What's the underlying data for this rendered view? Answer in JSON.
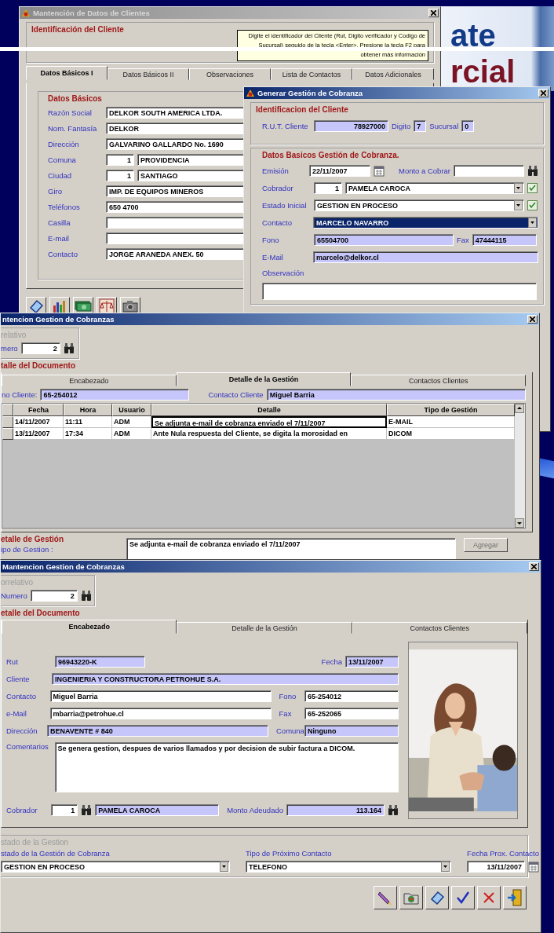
{
  "slide_heading": {
    "line_1": "ate",
    "line_2": "rcial"
  },
  "client_window": {
    "title": "Mantención de Datos de Clientes",
    "active": false,
    "id_group": {
      "title": "Identificación del Cliente",
      "hint": "Digite el identificador del Cliente (Rut, Digito verificador y Codigo de Sucursal) seguido de la tecla <Enter>. Presione la tecla F2 para obtener más información"
    },
    "tabs": [
      {
        "label": "Datos Básicos I",
        "selected": true
      },
      {
        "label": "Datos Básicos II",
        "selected": false
      },
      {
        "label": "Observaciones",
        "selected": false
      },
      {
        "label": "Lista de Contactos",
        "selected": false
      },
      {
        "label": "Datos Adicionales",
        "selected": false
      }
    ],
    "group_title": "Datos Básicos",
    "fields": [
      {
        "label": "Razón Social",
        "value": "DELKOR SOUTH AMERICA LTDA."
      },
      {
        "label": "Nom. Fantasía",
        "value": "DELKOR"
      },
      {
        "label": "Dirección",
        "value": "GALVARINO GALLARDO  No. 1690"
      },
      {
        "label": "Comuna",
        "code": "1",
        "value": "PROVIDENCIA"
      },
      {
        "label": "Ciudad",
        "code": "1",
        "value": "SANTIAGO"
      },
      {
        "label": "Giro",
        "value": "IMP. DE EQUIPOS MINEROS"
      },
      {
        "label": "Teléfonos",
        "value": "650 4700"
      },
      {
        "label": "Casilla"
      },
      {
        "label": "E-mail"
      },
      {
        "label": "Contacto",
        "value": "JORGE ARANEDA ANEX. 50"
      }
    ]
  },
  "gestion_window": {
    "title": "Generar Gestión de Cobranza",
    "active": true,
    "id_group": {
      "title": "Identificacion del Cliente",
      "rut_label": "R.U.T. Cliente",
      "rut": "78927000",
      "digit_label": "Digito",
      "digit": "7",
      "branch_label": "Sucursal",
      "branch": "0"
    },
    "data_group": {
      "title": "Datos Basicos Gestión de Cobranza.",
      "issue_label": "Emisión",
      "issue_date": "22/11/2007",
      "amount_label": "Monto a Cobrar",
      "collector_label": "Cobrador",
      "collector_code": "1",
      "collector": "PAMELA CAROCA",
      "status_label": "Estado Inicial",
      "status": "GESTION EN PROCESO",
      "contact_label": "Contacto",
      "contact": "MARCELO NAVARRO",
      "contact_highlighted": true,
      "phone_label": "Fono",
      "phone": "65504700",
      "fax_label": "Fax",
      "fax": "47444115",
      "email_label": "E-Mail",
      "email": "marcelo@delkor.cl",
      "notes_label": "Observación"
    }
  },
  "grid_window": {
    "title": "ntencion Gestion de Cobranzas",
    "active": true,
    "number_group": "relativo",
    "number_label": "mero",
    "number": "2",
    "doc_group": "talle del Documento",
    "tabs": [
      {
        "label": "Encabezado",
        "selected": false
      },
      {
        "label": "Detalle de la Gestión",
        "selected": true
      },
      {
        "label": "Contactos Clientes",
        "selected": false
      }
    ],
    "phone_label": "no Cliente:",
    "phone": "65-254012",
    "contact_label": "Contacto Cliente",
    "contact": "Miguel Barria",
    "columns": [
      "Fecha",
      "Hora",
      "Usuario",
      "Detalle",
      "Tipo de Gestión"
    ],
    "rows": [
      {
        "date": "14/11/2007",
        "time": "11:11",
        "user": "ADM",
        "detail": "Se adjunta e-mail de cobranza enviado el 7/11/2007",
        "type": "E-MAIL",
        "focused": true
      },
      {
        "date": "13/11/2007",
        "time": "17:34",
        "user": "ADM",
        "detail": "Ante Nula respuesta del Cliente, se digita la morosidad en",
        "type": "DICOM",
        "focused": false
      }
    ],
    "detail_title": "etalle de Gestión",
    "type_label": "ipo de Gestion :",
    "detail_text": "Se adjunta e-mail de cobranza enviado el 7/11/2007",
    "add_button": {
      "label": "Agregar",
      "disabled": true
    }
  },
  "header_window": {
    "title": "Mantencion Gestion de Cobranzas",
    "active": true,
    "number_group": "orrelativo",
    "number_label": "Numero",
    "number": "2",
    "doc_group": "etalle del Documento",
    "tabs": [
      {
        "label": "Encabezado",
        "selected": true
      },
      {
        "label": "Detalle de la Gestión",
        "selected": false
      },
      {
        "label": "Contactos Clientes",
        "selected": false
      }
    ],
    "rut_label": "Rut",
    "rut": "96943220-K",
    "date_label": "Fecha",
    "date": "13/11/2007",
    "client_label": "Cliente",
    "client": "INGENIERIA Y CONSTRUCTORA PETROHUE S.A.",
    "contact_label": "Contacto",
    "contact": "Miguel Barria",
    "phone_label": "Fono",
    "phone": "65-254012",
    "email_label": "e-Mail",
    "email": "mbarria@petrohue.cl",
    "fax_label": "Fax",
    "fax": "65-252065",
    "address_label": "Dirección",
    "address": "BENAVENTE # 840",
    "commune_label": "Comuna",
    "commune": "Ninguno",
    "comments_label": "Comentarios",
    "comments": "Se genera gestion, despues de varios llamados y por decision de subir factura a DICOM.",
    "collector_label": "Cobrador",
    "collector_code": "1",
    "collector": "PAMELA CAROCA",
    "debt_label": "Monto Adeudado",
    "debt": "113.164",
    "state_group": "stado de la Gestion",
    "status_label": "stado de la Gestión de Cobranza",
    "status": "GESTION EN PROCESO",
    "next_type_label": "Tipo de Próximo Contacto",
    "next_type": "TELEFONO",
    "next_date_label": "Fecha Prox. Contacto",
    "next_date": "13/11/2007"
  }
}
